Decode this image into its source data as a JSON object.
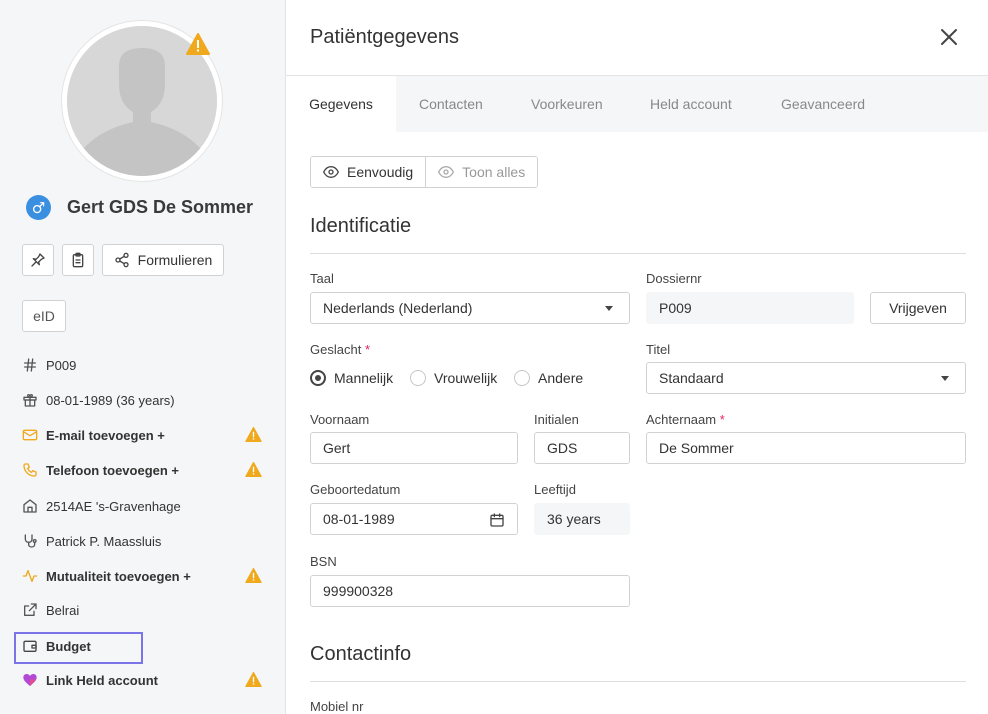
{
  "sidebar": {
    "patient_name": "Gert GDS De Sommer",
    "gender_symbol": "♂",
    "forms_label": "Formulieren",
    "eid_label": "eID",
    "items": [
      {
        "icon": "hash-icon",
        "label": "P009",
        "bold": false,
        "warning": false
      },
      {
        "icon": "gift-icon",
        "label": "08-01-1989 (36 years)",
        "bold": false,
        "warning": false
      },
      {
        "icon": "mail-icon",
        "label": "E-mail toevoegen +",
        "bold": true,
        "warning": true
      },
      {
        "icon": "phone-icon",
        "label": "Telefoon toevoegen +",
        "bold": true,
        "warning": true
      },
      {
        "icon": "home-icon",
        "label": "2514AE 's-Gravenhage",
        "bold": false,
        "warning": false
      },
      {
        "icon": "stethoscope-icon",
        "label": "Patrick P. Maassluis",
        "bold": false,
        "warning": false
      },
      {
        "icon": "activity-icon",
        "label": "Mutualiteit toevoegen +",
        "bold": true,
        "warning": true
      },
      {
        "icon": "external-link-icon",
        "label": "Belrai",
        "bold": false,
        "warning": false
      },
      {
        "icon": "wallet-icon",
        "label": "Budget",
        "bold": true,
        "warning": false
      },
      {
        "icon": "heart-icon",
        "label": "Link Held account",
        "bold": true,
        "warning": true
      }
    ]
  },
  "panel": {
    "title": "Patiëntgegevens",
    "tabs": [
      "Gegevens",
      "Contacten",
      "Voorkeuren",
      "Held account",
      "Geavanceerd"
    ],
    "active_tab": "Gegevens",
    "view_simple": "Eenvoudig",
    "view_all": "Toon alles"
  },
  "identificatie": {
    "heading": "Identificatie",
    "taal_label": "Taal",
    "taal_value": "Nederlands (Nederland)",
    "dossiernr_label": "Dossiernr",
    "dossiernr_value": "P009",
    "release_button": "Vrijgeven",
    "geslacht_label": "Geslacht",
    "required_mark": "*",
    "gender_options": [
      "Mannelijk",
      "Vrouwelijk",
      "Andere"
    ],
    "gender_selected": "Mannelijk",
    "titel_label": "Titel",
    "titel_value": "Standaard",
    "voornaam_label": "Voornaam",
    "voornaam_value": "Gert",
    "initialen_label": "Initialen",
    "initialen_value": "GDS",
    "achternaam_label": "Achternaam",
    "achternaam_value": "De Sommer",
    "geboortedatum_label": "Geboortedatum",
    "geboortedatum_value": "08-01-1989",
    "leeftijd_label": "Leeftijd",
    "leeftijd_value": "36 years",
    "bsn_label": "BSN",
    "bsn_value": "999900328"
  },
  "contactinfo": {
    "heading": "Contactinfo",
    "mobiel_label": "Mobiel nr"
  },
  "colors": {
    "warning": "#f0a81c",
    "gender_badge": "#3b8fe0",
    "focus_outline": "#7a74e8",
    "required": "#e0245e"
  }
}
